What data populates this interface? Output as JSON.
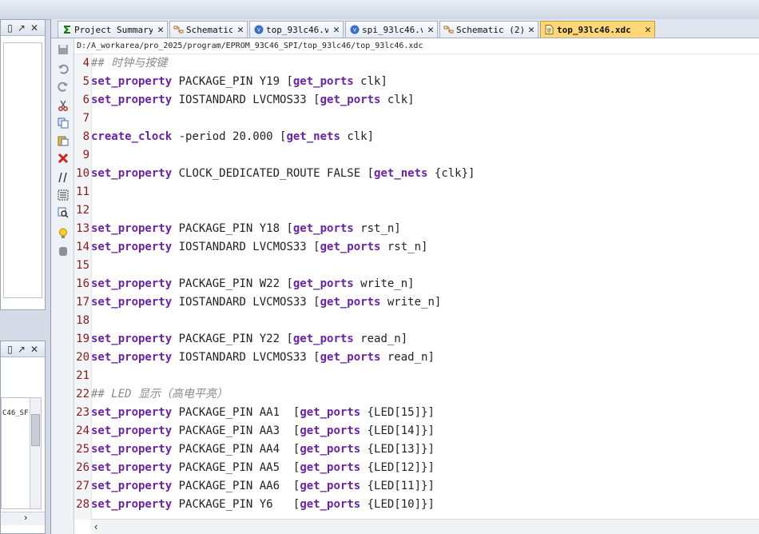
{
  "left_panels": {
    "top_header_icons": [
      "▯",
      "↗",
      "✕"
    ],
    "bottom_header_icons": [
      "▯",
      "↗",
      "✕"
    ],
    "bottom_partial_text": "C46_SF"
  },
  "tabs": [
    {
      "label": "Project Summary",
      "icon": "sigma-icon",
      "active": false
    },
    {
      "label": "Schematic",
      "icon": "schematic-icon",
      "active": false
    },
    {
      "label": "top_93lc46.v",
      "icon": "verilog-icon",
      "active": false
    },
    {
      "label": "spi_93lc46.v",
      "icon": "verilog-icon",
      "active": false
    },
    {
      "label": "Schematic (2)",
      "icon": "schematic-icon",
      "active": false
    },
    {
      "label": "top_93lc46.xdc",
      "icon": "xdc-file-icon",
      "active": true
    }
  ],
  "tab_close": "✕",
  "file_path": "D:/A_workarea/pro_2025/program/EPROM_93C46_SPI/top_93lc46/top_93lc46.xdc",
  "code_lines": [
    {
      "num": "4",
      "kw": "",
      "rest": "",
      "comment": "## 时钟与按键"
    },
    {
      "num": "5",
      "kw": "set_property",
      "rest": " PACKAGE_PIN Y19 [",
      "kw2": "get_ports",
      "tail": " clk]"
    },
    {
      "num": "6",
      "kw": "set_property",
      "rest": " IOSTANDARD LVCMOS33 [",
      "kw2": "get_ports",
      "tail": " clk]"
    },
    {
      "num": "7",
      "kw": "",
      "rest": ""
    },
    {
      "num": "8",
      "kw": "create_clock",
      "rest": " -period 20.000 [",
      "kw2": "get_nets",
      "tail": " clk]"
    },
    {
      "num": "9",
      "kw": "",
      "rest": ""
    },
    {
      "num": "10",
      "kw": "set_property",
      "rest": " CLOCK_DEDICATED_ROUTE FALSE [",
      "kw2": "get_nets",
      "tail": " {clk}]"
    },
    {
      "num": "11",
      "kw": "",
      "rest": ""
    },
    {
      "num": "12",
      "kw": "",
      "rest": ""
    },
    {
      "num": "13",
      "kw": "set_property",
      "rest": " PACKAGE_PIN Y18 [",
      "kw2": "get_ports",
      "tail": " rst_n]"
    },
    {
      "num": "14",
      "kw": "set_property",
      "rest": " IOSTANDARD LVCMOS33 [",
      "kw2": "get_ports",
      "tail": " rst_n]"
    },
    {
      "num": "15",
      "kw": "",
      "rest": ""
    },
    {
      "num": "16",
      "kw": "set_property",
      "rest": " PACKAGE_PIN W22 [",
      "kw2": "get_ports",
      "tail": " write_n]"
    },
    {
      "num": "17",
      "kw": "set_property",
      "rest": " IOSTANDARD LVCMOS33 [",
      "kw2": "get_ports",
      "tail": " write_n]"
    },
    {
      "num": "18",
      "kw": "",
      "rest": ""
    },
    {
      "num": "19",
      "kw": "set_property",
      "rest": " PACKAGE_PIN Y22 [",
      "kw2": "get_ports",
      "tail": " read_n]"
    },
    {
      "num": "20",
      "kw": "set_property",
      "rest": " IOSTANDARD LVCMOS33 [",
      "kw2": "get_ports",
      "tail": " read_n]"
    },
    {
      "num": "21",
      "kw": "",
      "rest": ""
    },
    {
      "num": "22",
      "kw": "",
      "rest": "",
      "comment": "## LED 显示（高电平亮）"
    },
    {
      "num": "23",
      "kw": "set_property",
      "rest": " PACKAGE_PIN AA1  [",
      "kw2": "get_ports",
      "tail": " {LED[15]}]"
    },
    {
      "num": "24",
      "kw": "set_property",
      "rest": " PACKAGE_PIN AA3  [",
      "kw2": "get_ports",
      "tail": " {LED[14]}]"
    },
    {
      "num": "25",
      "kw": "set_property",
      "rest": " PACKAGE_PIN AA4  [",
      "kw2": "get_ports",
      "tail": " {LED[13]}]"
    },
    {
      "num": "26",
      "kw": "set_property",
      "rest": " PACKAGE_PIN AA5  [",
      "kw2": "get_ports",
      "tail": " {LED[12]}]"
    },
    {
      "num": "27",
      "kw": "set_property",
      "rest": " PACKAGE_PIN AA6  [",
      "kw2": "get_ports",
      "tail": " {LED[11]}]"
    },
    {
      "num": "28",
      "kw": "set_property",
      "rest": " PACKAGE_PIN Y6   [",
      "kw2": "get_ports",
      "tail": " {LED[10]}]"
    }
  ],
  "colors": {
    "keyword": "#6a22a6",
    "line_number": "#8b1a1a",
    "active_tab": "#ffd777"
  }
}
